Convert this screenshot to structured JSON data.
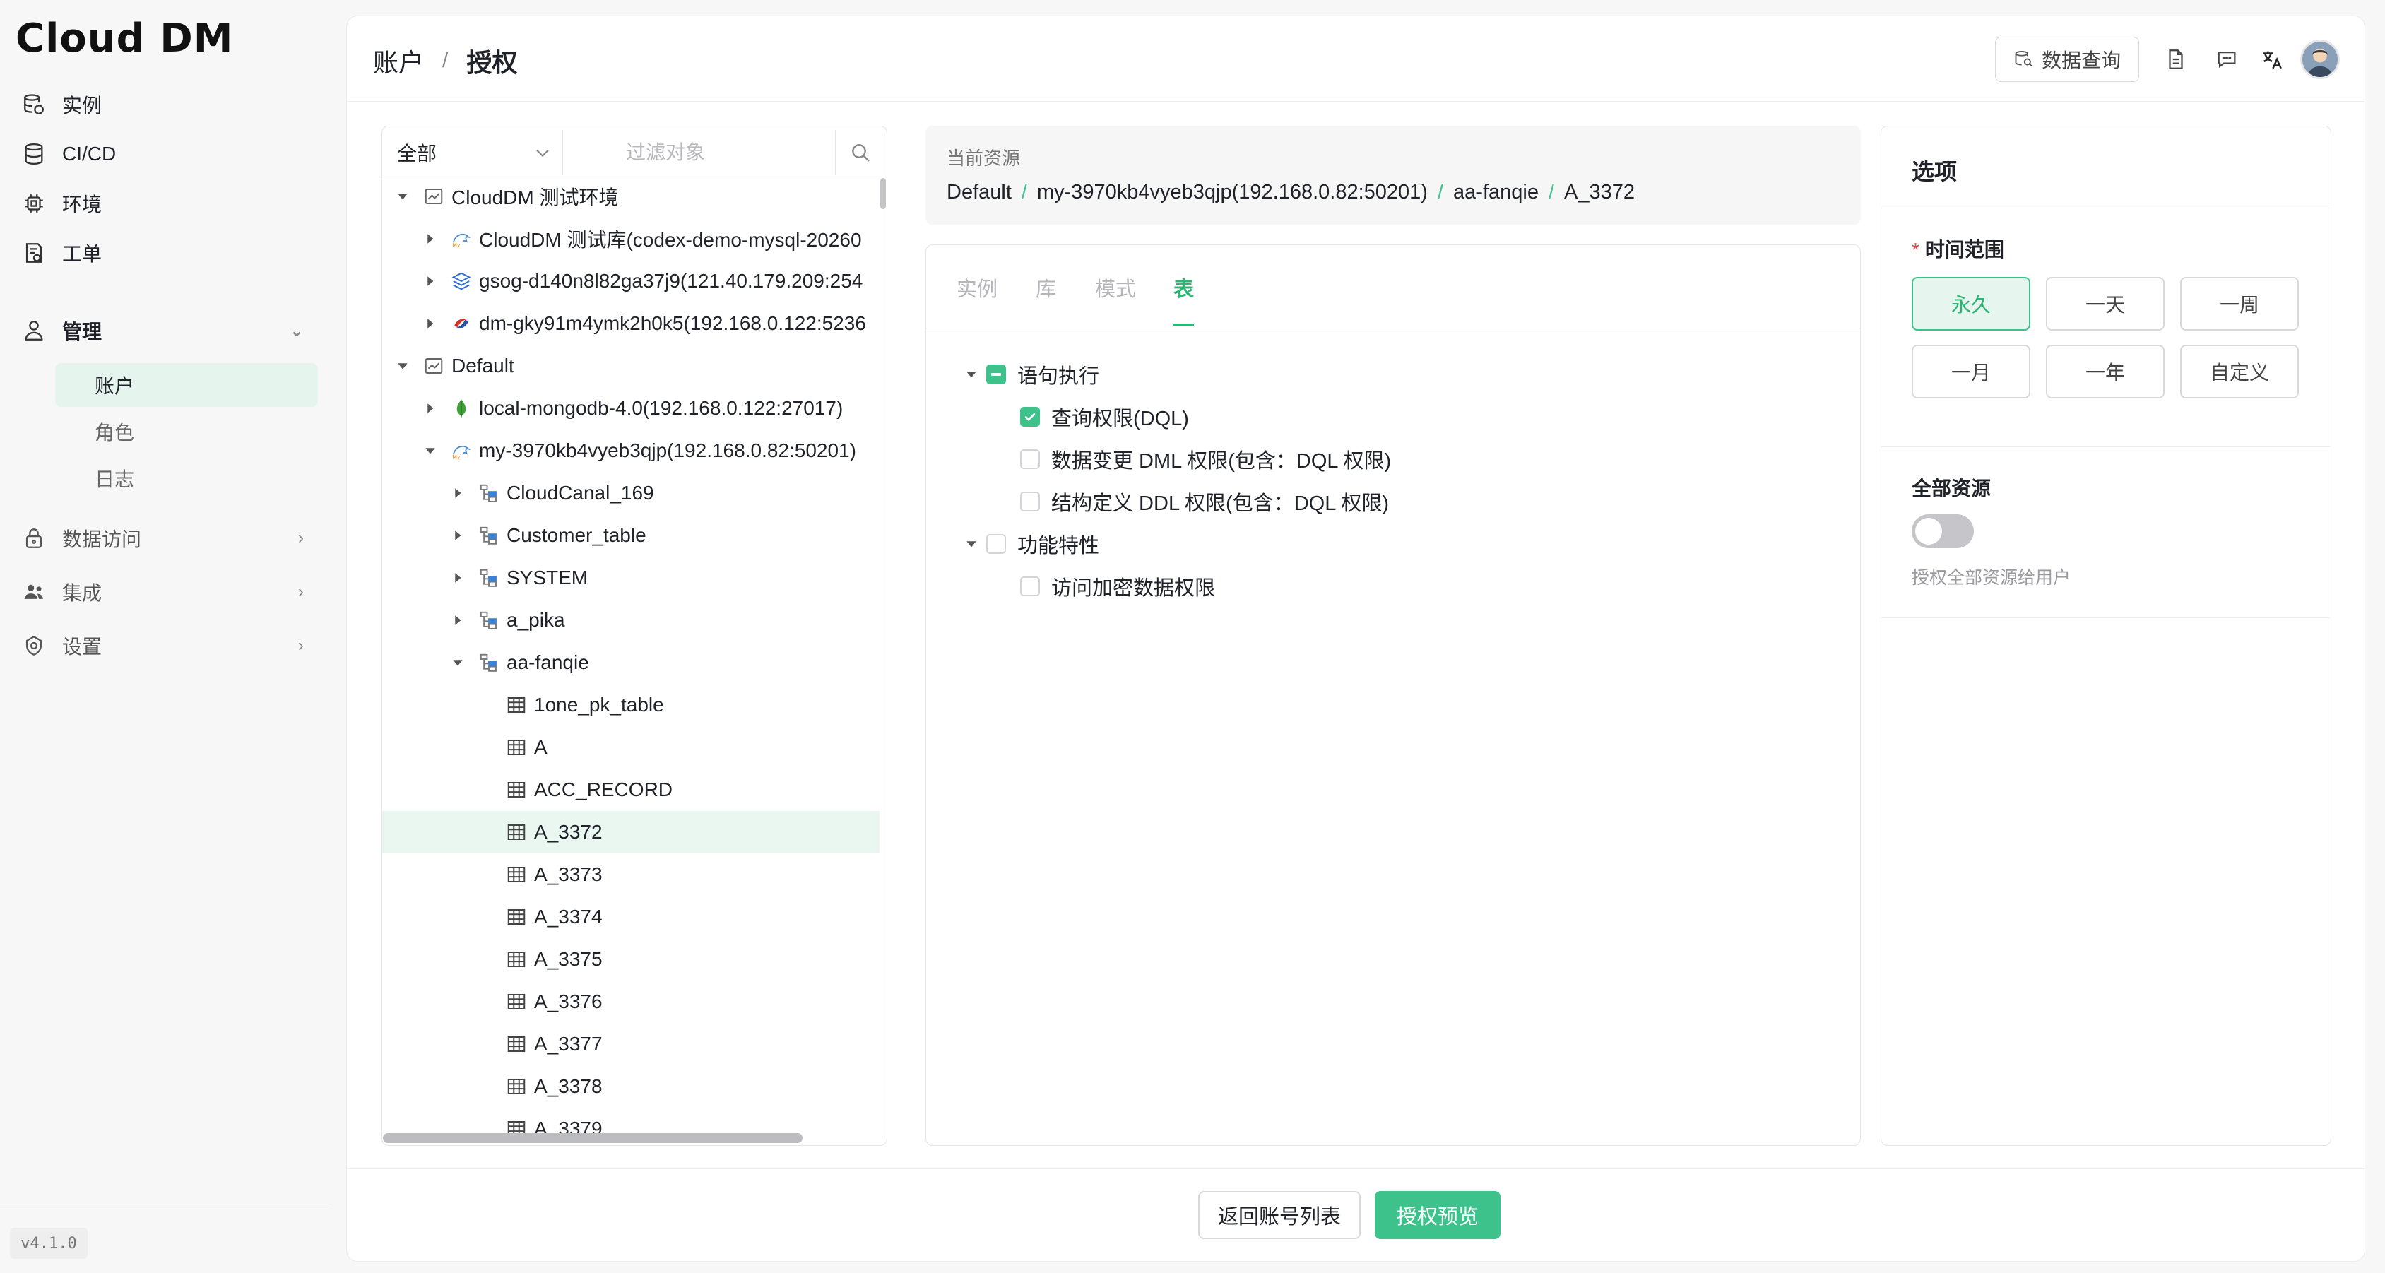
{
  "app": {
    "logo_bold": "Cl",
    "logo_thin": "ud",
    "logo_full": "Cloud DM",
    "version": "v4.1.0"
  },
  "sidebar": {
    "items": [
      {
        "label": "实例",
        "icon": "database-stack-icon"
      },
      {
        "label": "CI/CD",
        "icon": "database-icon"
      },
      {
        "label": "环境",
        "icon": "chip-icon"
      },
      {
        "label": "工单",
        "icon": "ticket-icon"
      },
      {
        "label": "管理",
        "icon": "user-icon",
        "expanded": true
      },
      {
        "label": "数据访问",
        "icon": "lock-icon"
      },
      {
        "label": "集成",
        "icon": "team-icon"
      },
      {
        "label": "设置",
        "icon": "settings-icon"
      }
    ],
    "admin_sub": [
      {
        "label": "账户",
        "active": true
      },
      {
        "label": "角色"
      },
      {
        "label": "日志"
      }
    ]
  },
  "header": {
    "breadcrumb": [
      "账户",
      "授权"
    ],
    "breadcrumb_sep": "/",
    "data_query_label": "数据查询"
  },
  "tree": {
    "filter_select": "全部",
    "filter_placeholder": "过滤对象",
    "nodes": [
      {
        "label": "CloudDM 测试环境",
        "level": 0,
        "expanded": true,
        "icon": "env-icon"
      },
      {
        "label": "CloudDM 测试库(codex-demo-mysql-20260",
        "level": 1,
        "expanded": false,
        "icon": "mysql-icon"
      },
      {
        "label": "gsog-d140n8l82ga37j9(121.40.179.209:254",
        "level": 1,
        "expanded": false,
        "icon": "layers-icon"
      },
      {
        "label": "dm-gky91m4ymk2h0k5(192.168.0.122:5236",
        "level": 1,
        "expanded": false,
        "icon": "dameng-icon"
      },
      {
        "label": "Default",
        "level": 0,
        "expanded": true,
        "icon": "env-icon"
      },
      {
        "label": "local-mongodb-4.0(192.168.0.122:27017)",
        "level": 1,
        "expanded": false,
        "icon": "mongodb-icon"
      },
      {
        "label": "my-3970kb4vyeb3qjp(192.168.0.82:50201)",
        "level": 1,
        "expanded": true,
        "icon": "mysql-icon"
      },
      {
        "label": "CloudCanal_169",
        "level": 2,
        "expanded": false,
        "icon": "schema-icon"
      },
      {
        "label": "Customer_table",
        "level": 2,
        "expanded": false,
        "icon": "schema-icon"
      },
      {
        "label": "SYSTEM",
        "level": 2,
        "expanded": false,
        "icon": "schema-icon"
      },
      {
        "label": "a_pika",
        "level": 2,
        "expanded": false,
        "icon": "schema-icon"
      },
      {
        "label": "aa-fanqie",
        "level": 2,
        "expanded": true,
        "icon": "schema-icon"
      },
      {
        "label": "1one_pk_table",
        "level": 3,
        "icon": "table-icon"
      },
      {
        "label": "A",
        "level": 3,
        "icon": "table-icon"
      },
      {
        "label": "ACC_RECORD",
        "level": 3,
        "icon": "table-icon"
      },
      {
        "label": "A_3372",
        "level": 3,
        "icon": "table-icon",
        "selected": true
      },
      {
        "label": "A_3373",
        "level": 3,
        "icon": "table-icon"
      },
      {
        "label": "A_3374",
        "level": 3,
        "icon": "table-icon"
      },
      {
        "label": "A_3375",
        "level": 3,
        "icon": "table-icon"
      },
      {
        "label": "A_3376",
        "level": 3,
        "icon": "table-icon"
      },
      {
        "label": "A_3377",
        "level": 3,
        "icon": "table-icon"
      },
      {
        "label": "A_3378",
        "level": 3,
        "icon": "table-icon"
      },
      {
        "label": "A_3379",
        "level": 3,
        "icon": "table-icon"
      }
    ]
  },
  "current_resource": {
    "title": "当前资源",
    "path": [
      "Default",
      "my-3970kb4vyeb3qjp(192.168.0.82:50201)",
      "aa-fanqie",
      "A_3372"
    ]
  },
  "tabs": [
    {
      "label": "实例",
      "active": false
    },
    {
      "label": "库",
      "active": false
    },
    {
      "label": "模式",
      "active": false
    },
    {
      "label": "表",
      "active": true
    }
  ],
  "permissions": [
    {
      "label": "语句执行",
      "level": 0,
      "state": "partial",
      "expanded": true
    },
    {
      "label": "查询权限(DQL)",
      "level": 1,
      "state": "checked"
    },
    {
      "label": "数据变更 DML 权限(包含：DQL 权限)",
      "level": 1,
      "state": "unchecked"
    },
    {
      "label": "结构定义 DDL 权限(包含：DQL 权限)",
      "level": 1,
      "state": "unchecked"
    },
    {
      "label": "功能特性",
      "level": 0,
      "state": "unchecked",
      "expanded": true
    },
    {
      "label": "访问加密数据权限",
      "level": 1,
      "state": "unchecked"
    }
  ],
  "options": {
    "title": "选项",
    "time_range_label": "时间范围",
    "required_mark": "*",
    "time_options": [
      {
        "label": "永久",
        "active": true
      },
      {
        "label": "一天"
      },
      {
        "label": "一周"
      },
      {
        "label": "一月"
      },
      {
        "label": "一年"
      },
      {
        "label": "自定义"
      }
    ],
    "all_resources_label": "全部资源",
    "all_resources_on": false,
    "all_resources_help": "授权全部资源给用户"
  },
  "footer": {
    "back_label": "返回账号列表",
    "preview_label": "授权预览"
  },
  "colors": {
    "accent": "#3ec28b",
    "accent_text": "#2bb673",
    "selected_bg": "#eaf6f0"
  }
}
